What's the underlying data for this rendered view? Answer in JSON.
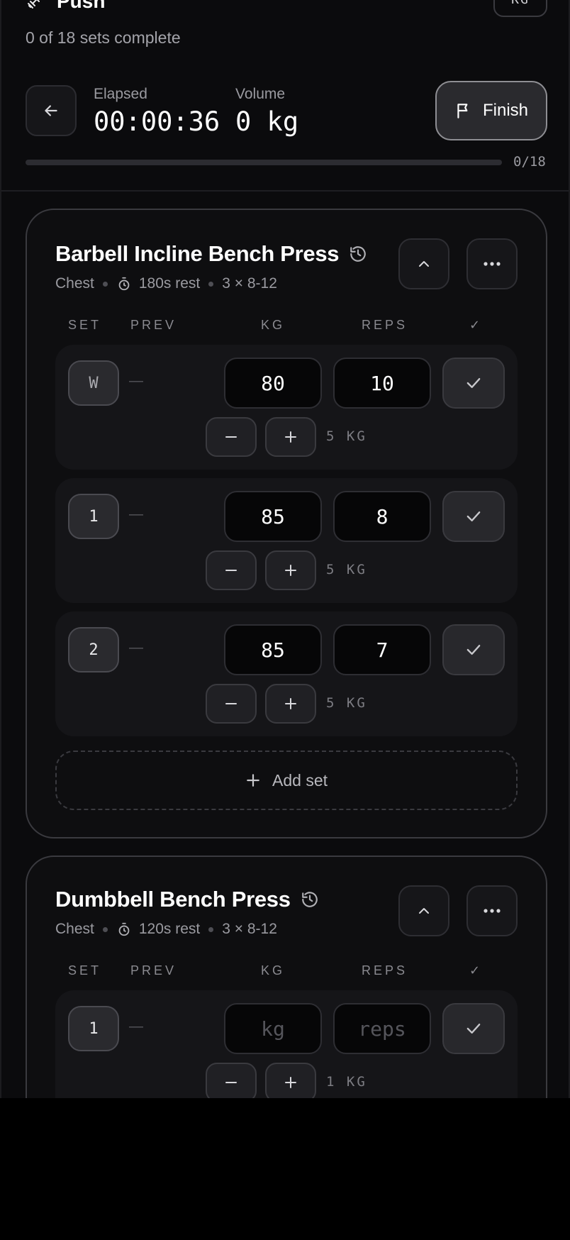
{
  "header": {
    "title": "Push",
    "unit": "KG",
    "progress_text": "0 of 18 sets complete",
    "elapsed_label": "Elapsed",
    "elapsed_value": "00:00:36",
    "volume_label": "Volume",
    "volume_value": "0 kg",
    "finish_label": "Finish",
    "progress_count": "0/18",
    "progress_fraction": 0
  },
  "columns": {
    "set": "SET",
    "prev": "PREV",
    "kg": "KG",
    "reps": "REPS",
    "done": "✓"
  },
  "exercises": [
    {
      "name": "Barbell Incline Bench Press",
      "muscle": "Chest",
      "rest": "180s rest",
      "scheme": "3 × 8-12",
      "sets": [
        {
          "label": "W",
          "prev": "—",
          "kg": "80",
          "reps": "10",
          "step": "5 KG"
        },
        {
          "label": "1",
          "prev": "—",
          "kg": "85",
          "reps": "8",
          "step": "5 KG"
        },
        {
          "label": "2",
          "prev": "—",
          "kg": "85",
          "reps": "7",
          "step": "5 KG"
        }
      ],
      "add_set_label": "Add set"
    },
    {
      "name": "Dumbbell Bench Press",
      "muscle": "Chest",
      "rest": "120s rest",
      "scheme": "3 × 8-12",
      "sets": [
        {
          "label": "1",
          "prev": "—",
          "kg_placeholder": "kg",
          "reps_placeholder": "reps",
          "step": "1 KG"
        }
      ]
    }
  ]
}
